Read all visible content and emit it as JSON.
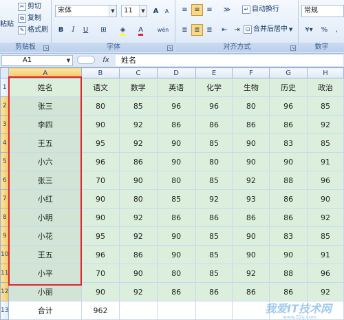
{
  "ribbon": {
    "clipboard": {
      "cut": "剪切",
      "copy": "复制",
      "format_painter": "格式刷",
      "paste": "粘贴",
      "label": "剪贴板"
    },
    "font": {
      "font_name": "宋体",
      "font_size": "11",
      "bold": "B",
      "italic": "I",
      "underline": "U",
      "grow": "A",
      "shrink": "A",
      "color_a": "A",
      "phonetic": "wén",
      "label": "字体"
    },
    "alignment": {
      "wrap_text": "自动换行",
      "merge_center": "合并后居中",
      "label": "对齐方式"
    },
    "number": {
      "format": "常规",
      "percent": "%",
      "comma": ",",
      "label": "数字"
    }
  },
  "formula_bar": {
    "name_box": "A1",
    "fx": "fx",
    "content": "姓名"
  },
  "columns": [
    "A",
    "B",
    "C",
    "D",
    "E",
    "F",
    "G",
    "H"
  ],
  "rows": [
    {
      "num": "1",
      "cells": [
        "姓名",
        "语文",
        "数学",
        "英语",
        "化学",
        "生物",
        "历史",
        "政治"
      ]
    },
    {
      "num": "2",
      "cells": [
        "张三",
        "80",
        "85",
        "96",
        "96",
        "80",
        "96",
        "85"
      ]
    },
    {
      "num": "3",
      "cells": [
        "李四",
        "90",
        "92",
        "86",
        "86",
        "86",
        "86",
        "92"
      ]
    },
    {
      "num": "4",
      "cells": [
        "王五",
        "95",
        "92",
        "90",
        "85",
        "90",
        "83",
        "85"
      ]
    },
    {
      "num": "5",
      "cells": [
        "小六",
        "96",
        "86",
        "90",
        "80",
        "90",
        "90",
        "91"
      ]
    },
    {
      "num": "6",
      "cells": [
        "张三",
        "70",
        "90",
        "80",
        "85",
        "92",
        "88",
        "96"
      ]
    },
    {
      "num": "7",
      "cells": [
        "小红",
        "90",
        "80",
        "85",
        "92",
        "93",
        "86",
        "90"
      ]
    },
    {
      "num": "8",
      "cells": [
        "小明",
        "90",
        "92",
        "86",
        "86",
        "86",
        "86",
        "92"
      ]
    },
    {
      "num": "9",
      "cells": [
        "小花",
        "95",
        "92",
        "90",
        "85",
        "90",
        "83",
        "85"
      ]
    },
    {
      "num": "10",
      "cells": [
        "王五",
        "96",
        "86",
        "90",
        "85",
        "90",
        "90",
        "91"
      ]
    },
    {
      "num": "11",
      "cells": [
        "小平",
        "70",
        "90",
        "80",
        "85",
        "92",
        "88",
        "96"
      ]
    },
    {
      "num": "12",
      "cells": [
        "小丽",
        "90",
        "92",
        "86",
        "86",
        "86",
        "86",
        "92"
      ]
    },
    {
      "num": "13",
      "cells": [
        "合计",
        "962",
        "",
        "",
        "",
        "",
        "",
        ""
      ]
    }
  ],
  "watermark": {
    "text": "我爱IT技术网",
    "url": "www.52ij.com"
  }
}
